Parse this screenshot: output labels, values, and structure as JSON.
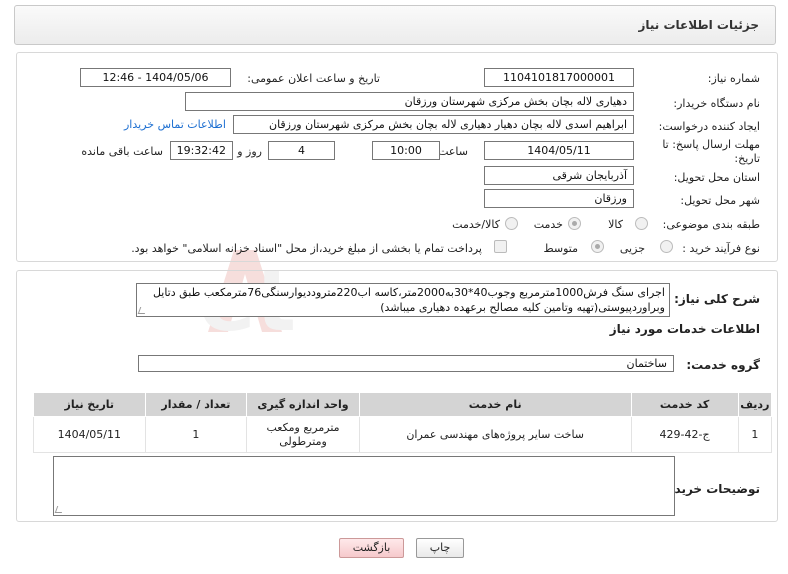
{
  "header": {
    "title": "جزئیات اطلاعات نیاز"
  },
  "form": {
    "need_number_label": "شماره نیاز:",
    "need_number": "1104101817000001",
    "announce_label": "تاریخ و ساعت اعلان عمومی:",
    "announce_value": "1404/05/06 - 12:46",
    "buyer_org_label": "نام دستگاه خریدار:",
    "buyer_org": "دهیاری لاله بچان بخش مرکزی شهرستان ورزقان",
    "creator_label": "ایجاد کننده درخواست:",
    "creator": "ابراهیم اسدی لاله بچان دهیار دهیاری لاله بچان بخش مرکزی شهرستان ورزقان",
    "contact_link": "اطلاعات تماس خریدار",
    "deadline_label": "مهلت ارسال پاسخ: تا تاریخ:",
    "deadline_date": "1404/05/11",
    "time_label": "ساعت",
    "deadline_time": "10:00",
    "days_value": "4",
    "days_label": "روز و",
    "remaining_time": "19:32:42",
    "remaining_label": "ساعت باقی مانده",
    "province_label": "استان محل تحویل:",
    "province": "آذربایجان شرقی",
    "city_label": "شهر محل تحویل:",
    "city": "ورزقان",
    "category_label": "طبقه بندی موضوعی:",
    "category_options": [
      "کالا",
      "خدمت",
      "کالا/خدمت"
    ],
    "category_selected": "خدمت",
    "purchase_type_label": "نوع فرآیند خرید :",
    "purchase_options": [
      "جزیی",
      "متوسط"
    ],
    "purchase_selected": "متوسط",
    "treasury_note": "پرداخت تمام یا بخشی از مبلغ خرید،از محل \"اسناد خزانه اسلامی\" خواهد بود."
  },
  "description": {
    "label": "شرح کلی نیاز:",
    "text": "اجرای سنگ فرش1000مترمربع وجوب40*30به2000متر،کاسه اب220متروددیوارسنگی76مترمکعب طبق دتایل وبراوردپیوستی(تهیه وتامین کلیه مصالح برعهده دهیاری میباشد)"
  },
  "services": {
    "section_title": "اطلاعات خدمات مورد نیاز",
    "group_label": "گروه خدمت:",
    "group_value": "ساختمان",
    "columns": [
      "ردیف",
      "کد خدمت",
      "نام خدمت",
      "واحد اندازه گیری",
      "تعداد / مقدار",
      "تاریخ نیاز"
    ],
    "rows": [
      {
        "row": "1",
        "code": "ج-42-429",
        "name": "ساخت سایر پروژه‌های مهندسی عمران",
        "unit": "مترمربع ومکعب ومترطولی",
        "qty": "1",
        "date": "1404/05/11"
      }
    ]
  },
  "notes": {
    "label": "توضیحات خریدار:"
  },
  "buttons": {
    "print": "چاپ",
    "back": "بازگشت"
  }
}
